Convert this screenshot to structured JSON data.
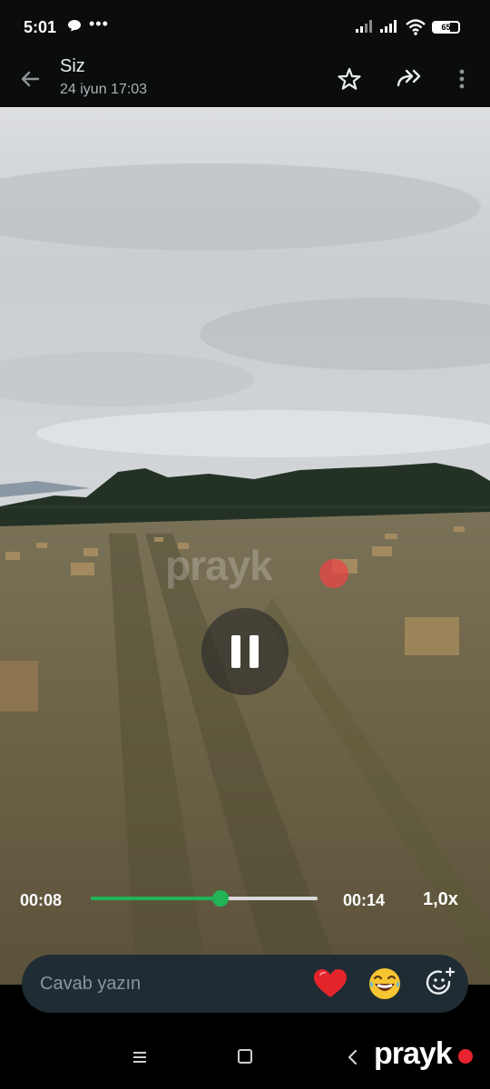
{
  "status_bar": {
    "time": "5:01",
    "more": "•••",
    "battery": "65"
  },
  "header": {
    "title": "Siz",
    "subtitle": "24 iyun 17:03"
  },
  "video": {
    "watermark": "prayk",
    "state": "playing",
    "progress_fraction": 0.57
  },
  "player": {
    "elapsed": "00:08",
    "total": "00:14",
    "speed": "1,0x"
  },
  "reply": {
    "placeholder": "Cavab yazın",
    "quick_reactions": [
      "❤️",
      "😂"
    ]
  },
  "branding": {
    "logo": "prayk"
  },
  "icons": [
    "back-arrow-icon",
    "star-icon",
    "forward-icon",
    "more-vert-icon",
    "pause-icon",
    "heart-icon",
    "laugh-icon",
    "emoji-add-icon"
  ],
  "colors": {
    "accent": "#21b356",
    "bar_bg": "#0b0d0c",
    "reply_bg": "#1f2c33",
    "logo_dot": "#e8232d"
  }
}
